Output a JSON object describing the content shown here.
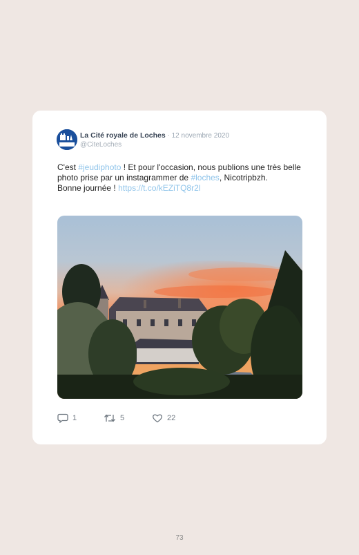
{
  "tweet": {
    "author_name": "La Cité royale de Loches",
    "separator": " · ",
    "date": "12 novembre 2020",
    "handle": "@CiteLoches",
    "avatar_text": "Loches",
    "text_parts": {
      "p1": "C'est ",
      "hashtag1": "#jeudiphoto",
      "p2": " ! Et pour l'occasion, nous publions une très belle photo prise par un instagrammer de ",
      "hashtag2": "#loches",
      "p3": ", Nicotripbzh.",
      "p4": "Bonne journée ! ",
      "link": "https://t.co/kEZiTQ8r2l"
    },
    "photo_icon": "chateau-sunset-photo",
    "actions": {
      "replies": "1",
      "retweets": "5",
      "likes": "22",
      "reply_icon": "reply-icon",
      "retweet_icon": "retweet-icon",
      "like_icon": "heart-icon"
    },
    "colors": {
      "link": "#8fc4ea",
      "avatar_bg": "#1a4f9c",
      "page_bg": "#efe7e3"
    }
  },
  "page": {
    "number": "73"
  }
}
